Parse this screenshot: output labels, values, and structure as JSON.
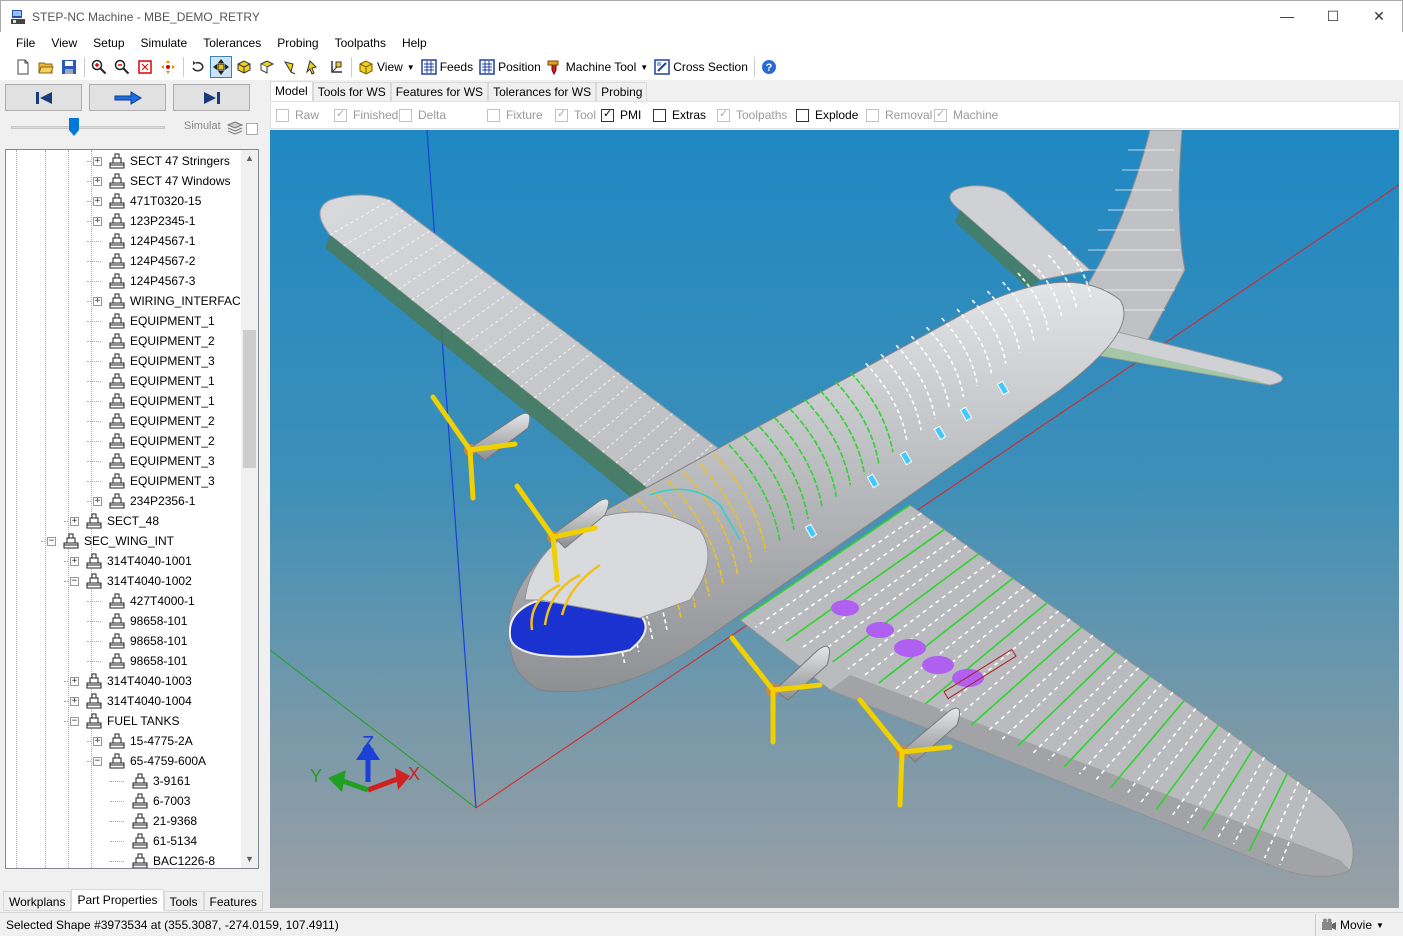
{
  "window": {
    "title": "STEP-NC Machine - MBE_DEMO_RETRY",
    "controls": [
      "minimize",
      "maximize",
      "close"
    ]
  },
  "menu": [
    "File",
    "View",
    "Setup",
    "Simulate",
    "Tolerances",
    "Probing",
    "Toolpaths",
    "Help"
  ],
  "toolbar": {
    "icon_buttons": [
      "new-icon",
      "open-icon",
      "save-icon",
      "zoom-in-icon",
      "zoom-out-icon",
      "zoom-fit-icon",
      "pan-icon",
      "rotate-icon",
      "pan-view-icon",
      "view-front-icon",
      "view-side-icon",
      "view-top-icon",
      "view-iso-icon",
      "view-axis-icon"
    ],
    "view_label": "View",
    "feeds_label": "Feeds",
    "position_label": "Position",
    "machine_tool_label": "Machine Tool",
    "cross_section_label": "Cross Section"
  },
  "left_panel": {
    "transport": [
      "skip-back-icon",
      "play-icon",
      "skip-forward-icon"
    ],
    "slider_label": "Simulat",
    "slider_level": 0.4,
    "tree": [
      {
        "label": "SECT 47 Stringers",
        "level": 3,
        "expander": "+"
      },
      {
        "label": "SECT 47 Windows",
        "level": 3,
        "expander": "+"
      },
      {
        "label": "471T0320-15",
        "level": 3,
        "expander": "+"
      },
      {
        "label": "123P2345-1",
        "level": 3,
        "expander": "+"
      },
      {
        "label": "124P4567-1",
        "level": 3,
        "expander": ""
      },
      {
        "label": "124P4567-2",
        "level": 3,
        "expander": ""
      },
      {
        "label": "124P4567-3",
        "level": 3,
        "expander": ""
      },
      {
        "label": "WIRING_INTERFACE_F",
        "level": 3,
        "expander": "+"
      },
      {
        "label": "EQUIPMENT_1",
        "level": 3,
        "expander": ""
      },
      {
        "label": "EQUIPMENT_2",
        "level": 3,
        "expander": ""
      },
      {
        "label": "EQUIPMENT_3",
        "level": 3,
        "expander": ""
      },
      {
        "label": "EQUIPMENT_1",
        "level": 3,
        "expander": ""
      },
      {
        "label": "EQUIPMENT_1",
        "level": 3,
        "expander": ""
      },
      {
        "label": "EQUIPMENT_2",
        "level": 3,
        "expander": ""
      },
      {
        "label": "EQUIPMENT_2",
        "level": 3,
        "expander": ""
      },
      {
        "label": "EQUIPMENT_3",
        "level": 3,
        "expander": ""
      },
      {
        "label": "EQUIPMENT_3",
        "level": 3,
        "expander": ""
      },
      {
        "label": "234P2356-1",
        "level": 3,
        "expander": "+"
      },
      {
        "label": "SECT_48",
        "level": 2,
        "expander": "+"
      },
      {
        "label": "SEC_WING_INT",
        "level": 1,
        "expander": "-"
      },
      {
        "label": "314T4040-1001",
        "level": 2,
        "expander": "+"
      },
      {
        "label": "314T4040-1002",
        "level": 2,
        "expander": "-"
      },
      {
        "label": "427T4000-1",
        "level": 3,
        "expander": ""
      },
      {
        "label": "98658-101",
        "level": 3,
        "expander": ""
      },
      {
        "label": "98658-101",
        "level": 3,
        "expander": ""
      },
      {
        "label": "98658-101",
        "level": 3,
        "expander": ""
      },
      {
        "label": "314T4040-1003",
        "level": 2,
        "expander": "+"
      },
      {
        "label": "314T4040-1004",
        "level": 2,
        "expander": "+"
      },
      {
        "label": "FUEL TANKS",
        "level": 2,
        "expander": "-"
      },
      {
        "label": "15-4775-2A",
        "level": 3,
        "expander": "+"
      },
      {
        "label": "65-4759-600A",
        "level": 3,
        "expander": "-"
      },
      {
        "label": "3-9161",
        "level": 4,
        "expander": ""
      },
      {
        "label": "6-7003",
        "level": 4,
        "expander": ""
      },
      {
        "label": "21-9368",
        "level": 4,
        "expander": ""
      },
      {
        "label": "61-5134",
        "level": 4,
        "expander": ""
      },
      {
        "label": "BAC1226-8",
        "level": 4,
        "expander": ""
      }
    ],
    "tabs": [
      "Workplans",
      "Part Properties",
      "Tools",
      "Features"
    ],
    "active_tab": "Part Properties"
  },
  "view_tabs": [
    "Model",
    "Tools for WS",
    "Features for WS",
    "Tolerances for WS",
    "Probing"
  ],
  "active_view_tab": "Model",
  "display_options": [
    {
      "label": "Raw",
      "checked": false,
      "enabled": false
    },
    {
      "label": "Finished",
      "checked": true,
      "enabled": false
    },
    {
      "label": "Delta",
      "checked": false,
      "enabled": false
    },
    {
      "label": "Fixture",
      "checked": false,
      "enabled": false
    },
    {
      "label": "Tool",
      "checked": true,
      "enabled": false
    },
    {
      "label": "PMI",
      "checked": true,
      "enabled": true
    },
    {
      "label": "Extras",
      "checked": false,
      "enabled": true
    },
    {
      "label": "Toolpaths",
      "checked": true,
      "enabled": false
    },
    {
      "label": "Explode",
      "checked": false,
      "enabled": true
    },
    {
      "label": "Removal",
      "checked": false,
      "enabled": false
    },
    {
      "label": "Machine",
      "checked": true,
      "enabled": false
    }
  ],
  "viewport": {
    "axis_labels": {
      "x": "X",
      "y": "Y",
      "z": "Z"
    },
    "colors": {
      "x_axis": "#e02020",
      "y_axis": "#20a020",
      "z_axis": "#1a40d8",
      "fuselage": "#c4c6c8",
      "ribs": "#2fd42f",
      "propeller": "#f0d000",
      "cockpit": "#1830d0",
      "tanks": "#b060f0"
    }
  },
  "status": {
    "text": "Selected Shape #3973534 at (355.3087, -274.0159, 107.4911)",
    "movie_label": "Movie"
  }
}
